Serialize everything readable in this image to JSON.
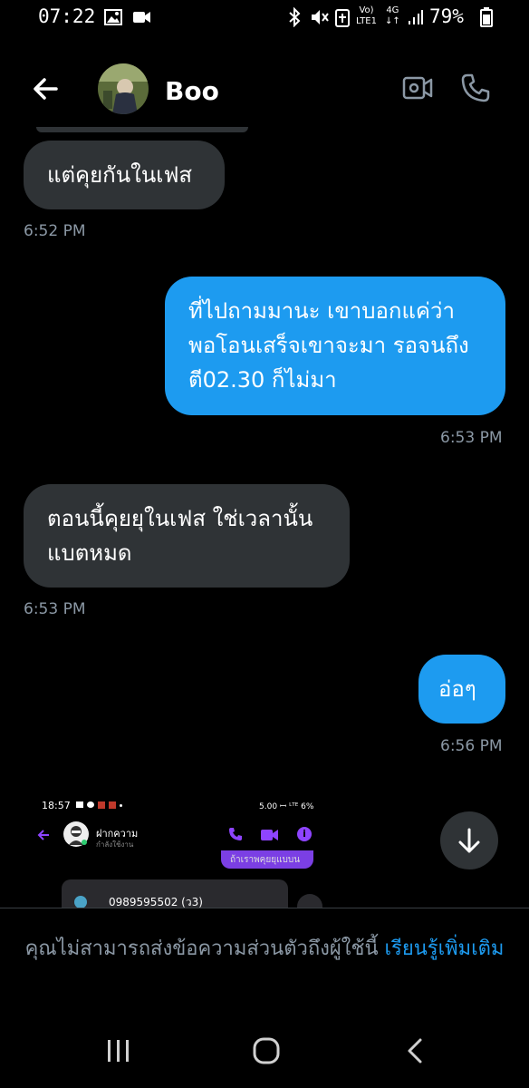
{
  "status_bar": {
    "time": "07:22",
    "network_top": "Vo)",
    "network_bottom": "LTE1",
    "net_type": "4G",
    "battery": "79%"
  },
  "header": {
    "contact_name": "Boo",
    "back_icon": "arrow-left-icon",
    "video_icon": "video-camera-icon",
    "call_icon": "phone-icon"
  },
  "messages": [
    {
      "direction": "in",
      "lines": [
        "แต่คุยกันในเฟส"
      ],
      "time": "6:52 PM"
    },
    {
      "direction": "out",
      "lines": [
        "ที่ไปถามมานะ เขาบอกแค่ว่า",
        "พอโอนเสร็จเขาจะมา รอจนถึง",
        "ตี02.30 ก็ไม่มา"
      ],
      "time": "6:53 PM"
    },
    {
      "direction": "in",
      "lines": [
        "ตอนนี้คุยยุในเฟส ใช่เวลานั้น",
        "แบตหมด"
      ],
      "time": "6:53 PM"
    },
    {
      "direction": "out",
      "lines": [
        "อ่อๆ"
      ],
      "time": "6:56 PM"
    }
  ],
  "embedded_screenshot": {
    "time": "18:57",
    "status_right": "5.00 ꟷ ᴸᵀᴱ 6%",
    "contact_name": "ฝากความ",
    "contact_status": "กำลังใช้งาน",
    "banner_text": "ถ้าเราพคุยยุแบบน",
    "phone_number": "0989595502 (ว3)"
  },
  "notice": {
    "text": "คุณไม่สามารถส่งข้อความส่วนตัวถึงผู้ใช้นี้ ",
    "link": "เรียนรู้เพิ่มเติม"
  },
  "colors": {
    "accent": "#1d9bf0",
    "incoming_bubble": "#2f3336",
    "background": "#000000"
  }
}
